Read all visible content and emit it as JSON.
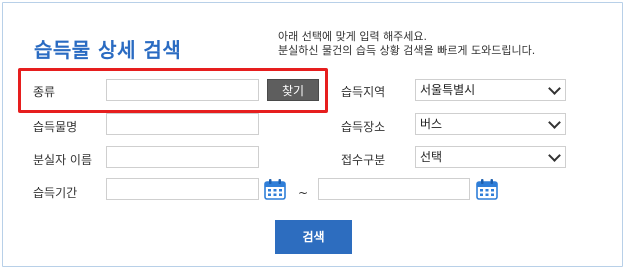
{
  "header": {
    "title": "습득물 상세 검색",
    "desc_line1": "아래 선택에 맞게 입력 해주세요.",
    "desc_line2": "분실하신 물건의 습득 상황 검색을 빠르게 도와드립니다."
  },
  "form": {
    "category_label": "종류",
    "find_button": "찾기",
    "item_name_label": "습득물명",
    "loser_name_label": "분실자 이름",
    "period_label": "습득기간",
    "period_separator": "~",
    "region_label": "습득지역",
    "region_value": "서울특별시",
    "place_label": "습득장소",
    "place_value": "버스",
    "receipt_label": "접수구분",
    "receipt_value": "선택",
    "search_button": "검색"
  },
  "colors": {
    "title": "#2a6bc2",
    "search_button": "#2d6dbf",
    "highlight": "#e61e1e",
    "find_button": "#5e5e5e"
  }
}
